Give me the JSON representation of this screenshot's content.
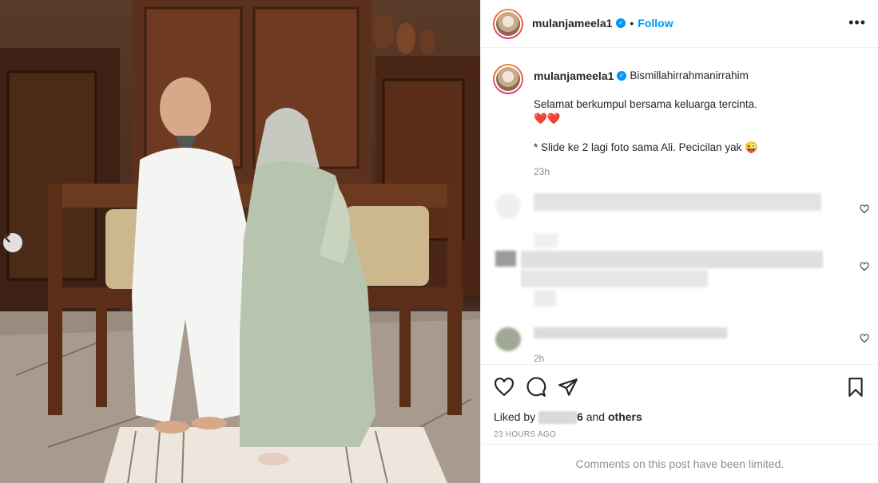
{
  "post": {
    "username": "mulanjameela1",
    "follow_label": "Follow",
    "dot": "•",
    "more_label": "•••",
    "caption_intro": "Bismillahirrahmanirrahim",
    "caption_line1": "Selamat berkumpul bersama keluarga tercinta.",
    "caption_hearts": "❤️❤️",
    "caption_line2": "* Slide ke 2 lagi foto sama Ali. Pecicilan yak 😜",
    "caption_time": "23h",
    "comment3_time": "2h"
  },
  "likes": {
    "prefix": "Liked by",
    "suffix_bold": "6",
    "and_text": " and ",
    "others": "others"
  },
  "post_time": "23 HOURS AGO",
  "comments_limited": "Comments on this post have been limited.",
  "colors": {
    "accent": "#0095f6",
    "text": "#262626",
    "muted": "#8e8e8e"
  }
}
